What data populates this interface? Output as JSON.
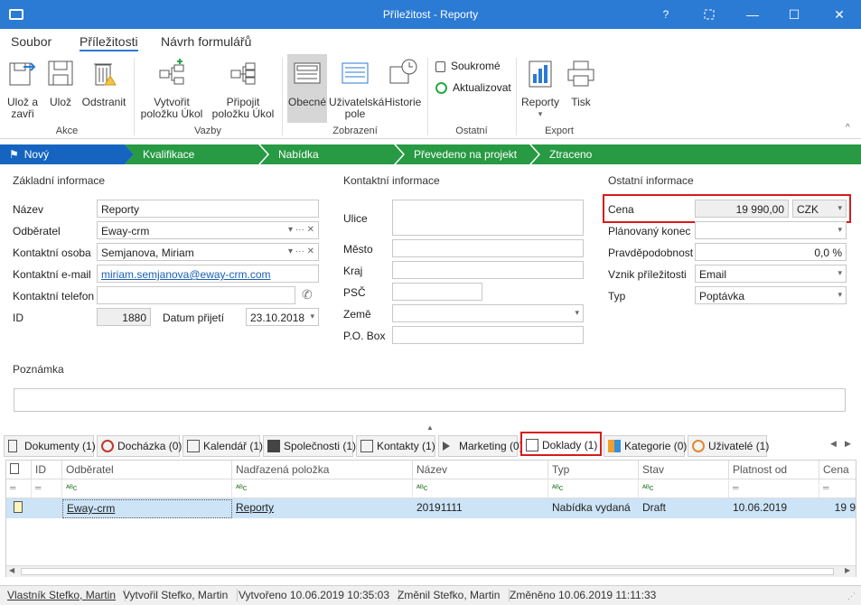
{
  "window": {
    "title": "Příležitost - Reporty",
    "help": "?",
    "minimize": "—",
    "maximize": "☐",
    "close": "✕"
  },
  "menu": {
    "soubor": "Soubor",
    "prilezitosti": "Příležitosti",
    "navrh": "Návrh formulářů"
  },
  "ribbon": {
    "uloz_a_zavri": "Ulož a zavři",
    "uloz": "Ulož",
    "odstranit": "Odstranit",
    "akce": "Akce",
    "vytvorit": "Vytvořit položku Úkol",
    "pripojit": "Připojit položku Úkol",
    "vazby": "Vazby",
    "obecne": "Obecné",
    "uzivatelska_pole": "Uživatelská pole",
    "historie": "Historie",
    "zobrazeni": "Zobrazení",
    "soukrome": "Soukromé",
    "aktualizovat": "Aktualizovat",
    "ostatni": "Ostatní",
    "reporty": "Reporty",
    "tisk": "Tisk",
    "export": "Export"
  },
  "stages": [
    "Nový",
    "Kvalifikace",
    "Nabídka",
    "Převedeno na projekt",
    "Ztraceno"
  ],
  "colors": {
    "titlebar": "#2b7ad4",
    "stage_active": "#1565c0",
    "stage_green": "#279a43",
    "highlight": "#d81b1b",
    "selected_row": "#cde4f7"
  },
  "basic": {
    "section": "Základní informace",
    "nazev_label": "Název",
    "nazev": "Reporty",
    "odberatel_label": "Odběratel",
    "odberatel": "Eway-crm",
    "osoba_label": "Kontaktní osoba",
    "osoba": "Semjanova, Miriam",
    "email_label": "Kontaktní e-mail",
    "email": "miriam.semjanova@eway-crm.com",
    "telefon_label": "Kontaktní telefon",
    "telefon": "",
    "id_label": "ID",
    "id": "1880",
    "datum_label": "Datum přijetí",
    "datum": "23.10.2018"
  },
  "contact": {
    "section": "Kontaktní informace",
    "ulice": "Ulice",
    "mesto": "Město",
    "kraj": "Kraj",
    "psc": "PSČ",
    "zeme": "Země",
    "pobox": "P.O. Box"
  },
  "other": {
    "section": "Ostatní informace",
    "cena_label": "Cena",
    "cena": "19 990,00",
    "mena": "CZK",
    "konec_label": "Plánovaný konec",
    "konec": "",
    "pravd_label": "Pravděpodobnost",
    "pravd": "0,0 %",
    "vznik_label": "Vznik příležitosti",
    "vznik": "Email",
    "typ_label": "Typ",
    "typ": "Poptávka"
  },
  "poznamka": "Poznámka",
  "tabs": [
    "Dokumenty (1)",
    "Docházka (0)",
    "Kalendář (1)",
    "Společnosti (1)",
    "Kontakty (1)",
    "Marketing (0)",
    "Doklady (1)",
    "Kategorie (0)",
    "Uživatelé (1)"
  ],
  "grid": {
    "headers": [
      "ID",
      "Odběratel",
      "Nadřazená položka",
      "Název",
      "Typ",
      "Stav",
      "Platnost od",
      "Cena"
    ],
    "filter": "ᴬᴮc",
    "row": {
      "id": "",
      "odberatel": "Eway-crm",
      "nadrazena": "Reporty",
      "nazev": "20191111",
      "typ": "Nabídka vydaná",
      "stav": "Draft",
      "platnost": "10.06.2019",
      "cena": "19 9"
    }
  },
  "status": {
    "vlastnik": "Vlastník Stefko, Martin",
    "vytvoril": "Vytvořil Stefko, Martin",
    "vytvoreno": "Vytvořeno 10.06.2019 10:35:03",
    "zmenil": "Změnil Stefko, Martin",
    "zmeneno": "Změněno 10.06.2019 11:11:33"
  }
}
